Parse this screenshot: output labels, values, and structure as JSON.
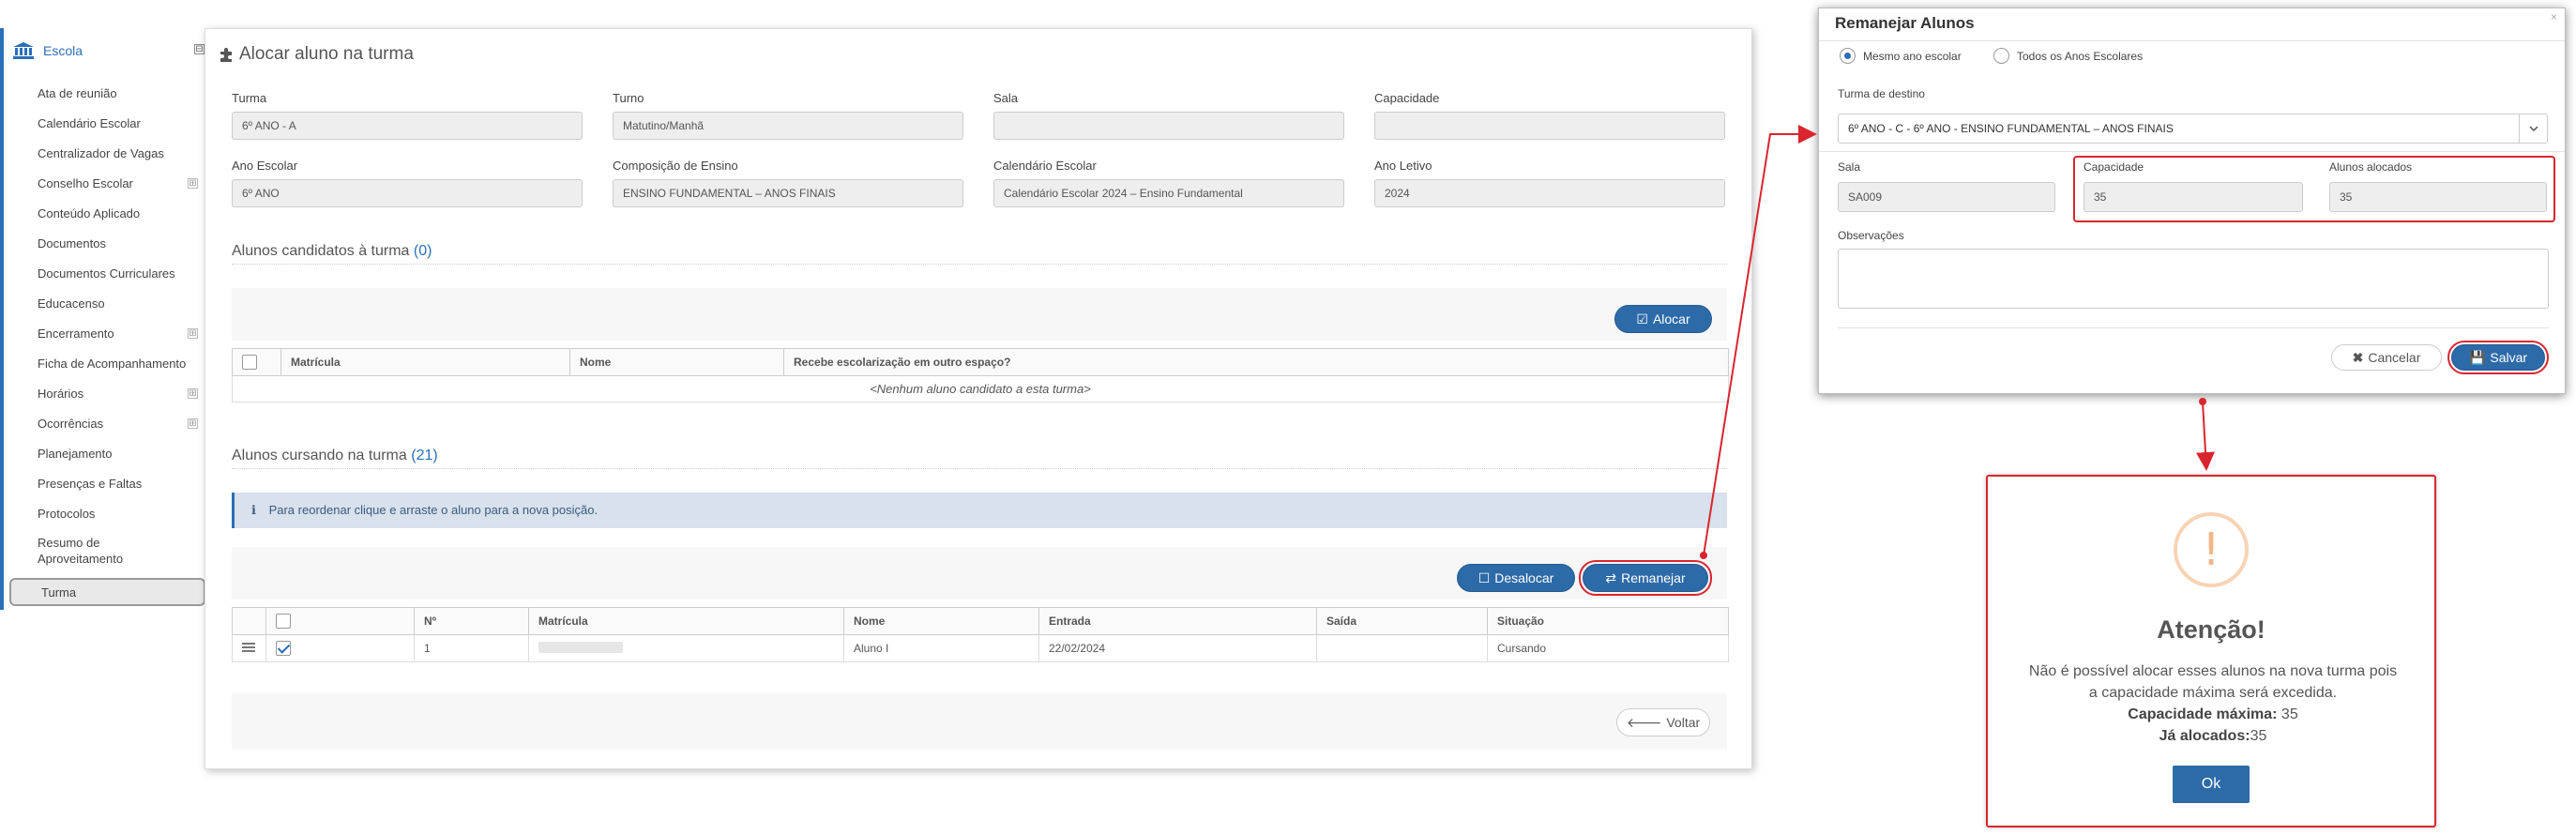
{
  "sidebar": {
    "header": "Escola",
    "collapse": "⊟",
    "items": [
      {
        "label": "Ata de reunião",
        "expand": ""
      },
      {
        "label": "Calendário Escolar",
        "expand": ""
      },
      {
        "label": "Centralizador de Vagas",
        "expand": ""
      },
      {
        "label": "Conselho Escolar",
        "expand": "⊞"
      },
      {
        "label": "Conteúdo Aplicado",
        "expand": ""
      },
      {
        "label": "Documentos",
        "expand": ""
      },
      {
        "label": "Documentos Curriculares",
        "expand": ""
      },
      {
        "label": "Educacenso",
        "expand": ""
      },
      {
        "label": "Encerramento",
        "expand": "⊞"
      },
      {
        "label": "Ficha de Acompanhamento",
        "expand": ""
      },
      {
        "label": "Horários",
        "expand": "⊞"
      },
      {
        "label": "Ocorrências",
        "expand": "⊞"
      },
      {
        "label": "Planejamento",
        "expand": ""
      },
      {
        "label": "Presenças e Faltas",
        "expand": ""
      },
      {
        "label": "Protocolos",
        "expand": ""
      },
      {
        "label": "Resumo de",
        "expand": ""
      },
      {
        "label": "Aproveitamento",
        "expand": ""
      }
    ],
    "active": "Turma"
  },
  "main": {
    "title": "Alocar aluno na turma",
    "fields": {
      "turma_label": "Turma",
      "turma_value": "6º ANO - A",
      "turno_label": "Turno",
      "turno_value": "Matutino/Manhã",
      "sala_label": "Sala",
      "sala_value": "",
      "capacidade_label": "Capacidade",
      "capacidade_value": "",
      "ano_escolar_label": "Ano Escolar",
      "ano_escolar_value": "6º ANO",
      "composicao_label": "Composição de Ensino",
      "composicao_value": "ENSINO FUNDAMENTAL – ANOS FINAIS",
      "calendario_label": "Calendário Escolar",
      "calendario_value": "Calendário Escolar 2024 – Ensino Fundamental",
      "ano_letivo_label": "Ano Letivo",
      "ano_letivo_value": "2024"
    },
    "candidatos": {
      "title": "Alunos candidatos à turma",
      "count": "(0)",
      "alocar_label": "Alocar",
      "columns": [
        "Matrícula",
        "Nome",
        "Recebe escolarização em outro espaço?"
      ],
      "empty": "<Nenhum aluno candidato a esta turma>"
    },
    "cursando": {
      "title": "Alunos cursando na turma",
      "count": "(21)",
      "info": "Para reordenar clique e arraste o aluno para a nova posição.",
      "desalocar_label": "Desalocar",
      "remanejar_label": "Remanejar",
      "columns": [
        "Nº",
        "Matrícula",
        "Nome",
        "Entrada",
        "Saída",
        "Situação"
      ],
      "rows": [
        {
          "num": "1",
          "matricula": "",
          "nome": "Aluno I",
          "entrada": "22/02/2024",
          "saida": "",
          "situacao": "Cursando",
          "checked": true
        }
      ]
    },
    "voltar_label": "Voltar"
  },
  "modal": {
    "title": "Remanejar Alunos",
    "close": "×",
    "radio_mesmo": "Mesmo ano escolar",
    "radio_todos": "Todos os Anos Escolares",
    "turma_destino_label": "Turma de destino",
    "turma_destino_value": "6º ANO - C - 6º ANO - ENSINO FUNDAMENTAL – ANOS FINAIS",
    "sala_label": "Sala",
    "sala_value": "SA009",
    "capacidade_label": "Capacidade",
    "capacidade_value": "35",
    "alocados_label": "Alunos alocados",
    "alocados_value": "35",
    "observacoes_label": "Observações",
    "cancelar_label": "Cancelar",
    "salvar_label": "Salvar"
  },
  "alert": {
    "icon": "!",
    "title": "Atenção!",
    "message": "Não é possível alocar esses alunos na nova turma pois a capacidade máxima será excedida.",
    "cap_label": "Capacidade máxima:",
    "cap_value": " 35",
    "aloc_label": "Já alocados:",
    "aloc_value": "35",
    "ok_label": "Ok"
  },
  "colors": {
    "accent": "#2d6aa8",
    "highlight": "#d9252e"
  }
}
